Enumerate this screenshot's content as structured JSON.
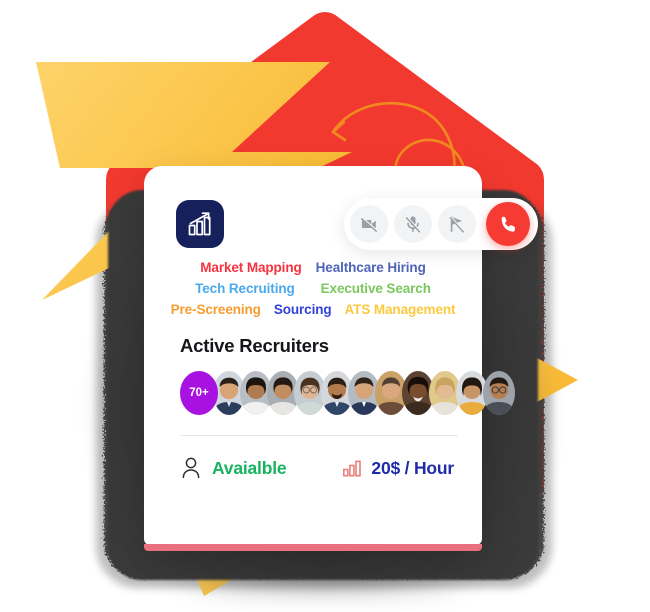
{
  "card": {
    "brand": {
      "logo_icon": "bar-chart-growth-icon",
      "logo_bg": "#16215c"
    },
    "call_controls": [
      {
        "id": "video-off",
        "icon": "video-camera-off-icon",
        "label": "Video off",
        "state": "muted"
      },
      {
        "id": "mic-off",
        "icon": "microphone-off-icon",
        "label": "Microphone off",
        "state": "muted"
      },
      {
        "id": "screen-share-off",
        "icon": "screen-share-off-icon",
        "label": "Screen share off",
        "state": "muted"
      },
      {
        "id": "end-call",
        "icon": "phone-icon",
        "label": "End call",
        "state": "active"
      }
    ],
    "tag_rows": [
      [
        {
          "label": "Market Mapping",
          "color": "#f5333f"
        },
        {
          "label": "Healthcare  Hiring",
          "color": "#4f63b8"
        }
      ],
      [
        {
          "label": "Tech Recruiting",
          "color": "#4aa8ec"
        },
        {
          "label": "Executive Search",
          "color": "#7ac85e"
        }
      ],
      [
        {
          "label": "Pre-Screening",
          "color": "#f79c2e"
        },
        {
          "label": "Sourcing",
          "color": "#3143d8"
        },
        {
          "label": "ATS  Management",
          "color": "#fcc83c"
        }
      ]
    ],
    "section_title": "Active Recruiters",
    "recruiters": {
      "count_badge": "70+",
      "badge_color": "#a812e0",
      "avatars": [
        {
          "name": "recruiter-1",
          "skin": "#d9a378",
          "hair": "#2b2118",
          "shirt": "#2b3d5c",
          "bg": "#cfd6dd"
        },
        {
          "name": "recruiter-2",
          "skin": "#b07a4f",
          "hair": "#1d1410",
          "shirt": "#f2f0ee",
          "bg": "#b9bec4"
        },
        {
          "name": "recruiter-3",
          "skin": "#c18d5e",
          "hair": "#241a13",
          "shirt": "#e8e6e3",
          "bg": "#a9aeb3"
        },
        {
          "name": "recruiter-4",
          "skin": "#e0b48e",
          "hair": "#4a3221",
          "shirt": "#cfd9d6",
          "bg": "#c5ccd2"
        },
        {
          "name": "recruiter-5",
          "skin": "#b47c4e",
          "hair": "#2d1f16",
          "shirt": "#2f4668",
          "bg": "#d4d8dc"
        },
        {
          "name": "recruiter-6",
          "skin": "#d7a47a",
          "hair": "#30231a",
          "shirt": "#27385a",
          "bg": "#b4bcc3"
        },
        {
          "name": "recruiter-7",
          "skin": "#d9a87f",
          "hair": "#514033",
          "shirt": "#6c4d3a",
          "bg": "#caa267"
        },
        {
          "name": "recruiter-8",
          "skin": "#7a4c2e",
          "hair": "#190f0a",
          "shirt": "#3d2a1f",
          "bg": "#5d4334"
        },
        {
          "name": "recruiter-9",
          "skin": "#e3bb93",
          "hair": "#c9a45e",
          "shirt": "#e6e2dc",
          "bg": "#e0c98a"
        },
        {
          "name": "recruiter-10",
          "skin": "#c89566",
          "hair": "#221812",
          "shirt": "#e8ad3c",
          "bg": "#d8dbde"
        },
        {
          "name": "recruiter-11",
          "skin": "#b57f52",
          "hair": "#241912",
          "shirt": "#4a4f56",
          "bg": "#9ca3ab"
        }
      ]
    },
    "footer": {
      "availability_icon": "person-outline-icon",
      "availability_label": "Avaialble",
      "availability_color": "#17b45f",
      "rate_icon": "bar-chart-small-icon",
      "rate_label": "20$ / Hour",
      "rate_color": "#1f2ba8"
    }
  },
  "background": {
    "pentagon_color": "#f2392f",
    "bolt_color": "#fbc549",
    "arrow_doodle_color": "#f08a1e",
    "shadow_color": "#3a3a3a"
  }
}
